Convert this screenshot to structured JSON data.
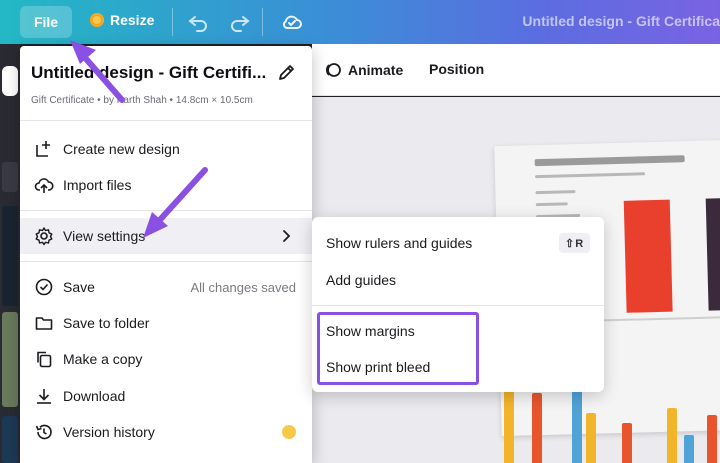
{
  "topbar": {
    "file_label": "File",
    "resize_label": "Resize",
    "doc_title": "Untitled design - Gift Certifica"
  },
  "toolbar": {
    "animate_label": "Animate",
    "position_label": "Position"
  },
  "file_menu": {
    "title": "Untitled design - Gift Certifi...",
    "subtitle": "Gift Certificate • by Parth Shah • 14.8cm × 10.5cm",
    "items": [
      {
        "label": "Create new design",
        "icon": "create-plus-icon"
      },
      {
        "label": "Import files",
        "icon": "cloud-upload-icon"
      },
      {
        "label": "View settings",
        "icon": "gear-icon"
      },
      {
        "label": "Save",
        "icon": "check-circle-icon",
        "status": "All changes saved"
      },
      {
        "label": "Save to folder",
        "icon": "folder-icon"
      },
      {
        "label": "Make a copy",
        "icon": "copy-icon"
      },
      {
        "label": "Download",
        "icon": "download-icon"
      },
      {
        "label": "Version history",
        "icon": "history-icon"
      }
    ]
  },
  "view_settings_menu": {
    "items": [
      {
        "label": "Show rulers and guides",
        "shortcut": "⇧R"
      },
      {
        "label": "Add guides"
      },
      {
        "label": "Show margins"
      },
      {
        "label": "Show print bleed"
      }
    ]
  },
  "colors": {
    "accent_purple": "#8a4fe3",
    "crown_gold": "#f7c948"
  }
}
